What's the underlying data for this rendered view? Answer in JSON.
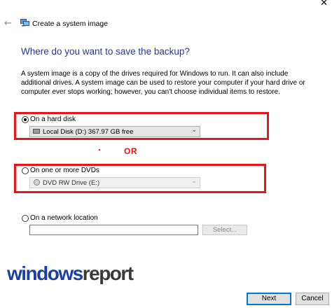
{
  "window": {
    "close_glyph": "✕"
  },
  "wizard": {
    "back_glyph": "←",
    "title": "Create a system image"
  },
  "heading": "Where do you want to save the backup?",
  "description": "A system image is a copy of the drives required for Windows to run. It can also include additional drives. A system image can be used to restore your computer if your hard drive or computer ever stops working; however, you can't choose individual items to restore.",
  "options": {
    "hard_disk": {
      "label": "On a hard disk",
      "selected": true,
      "dropdown_value": "Local Disk (D:)  367.97 GB free"
    },
    "dvd": {
      "label": "On one or more DVDs",
      "selected": false,
      "dropdown_value": "DVD RW Drive (E:)"
    },
    "network": {
      "label": "On a network location",
      "selected": false,
      "path_value": "",
      "select_button": "Select..."
    }
  },
  "annotation": {
    "or_text": "OR",
    "highlight_color": "#e8151b"
  },
  "watermark": {
    "part1": "windows",
    "part2": "report"
  },
  "footer": {
    "next_label": "Next",
    "cancel_label": "Cancel"
  },
  "icons": {
    "back": "back-arrow-icon",
    "wizard": "system-image-icon",
    "drive": "hard-drive-icon",
    "dvd": "dvd-drive-icon",
    "chevron": "chevron-down-icon"
  }
}
